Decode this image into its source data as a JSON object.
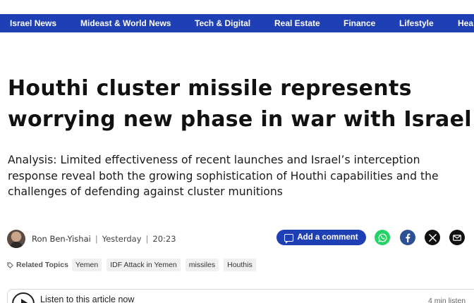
{
  "nav": {
    "items": [
      "Israel News",
      "Mideast & World News",
      "Tech & Digital",
      "Real Estate",
      "Finance",
      "Lifestyle",
      "Hea"
    ]
  },
  "article": {
    "headline": "Houthi cluster missile represents worrying new phase in war with Israel",
    "subhead": "Analysis: Limited effectiveness of recent launches and Israel’s interception response reveal both the growing sophistication of Houthi capabilities and the challenges of defending against cluster munitions",
    "author": "Ron Ben-Yishai",
    "separator": "|",
    "date": "Yesterday",
    "time": "20:23"
  },
  "actions": {
    "comment_label": "Add a comment",
    "share_icons": [
      "whatsapp-icon",
      "facebook-icon",
      "x-icon",
      "email-icon"
    ]
  },
  "topics": {
    "label": "Related Topics",
    "items": [
      "Yemen",
      "IDF Attack in Yemen",
      "missiles",
      "Houthis"
    ]
  },
  "listen": {
    "label": "Listen to this article now",
    "duration": "4 min listen"
  },
  "colors": {
    "nav_bg": "#1f3fb5",
    "whatsapp": "#25d366",
    "facebook": "#2d4f93",
    "x": "#111111",
    "email": "#111111"
  }
}
